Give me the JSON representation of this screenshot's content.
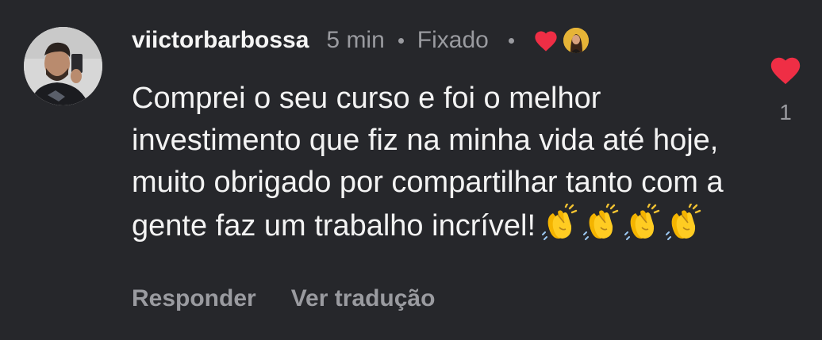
{
  "comment": {
    "username": "viictorbarbossa",
    "time": "5 min",
    "pinned_label": "Fixado",
    "text": "Comprei o seu curso e foi o melhor investimento que fiz na minha vida até hoje, muito obrigado por compartilhar tanto com a gente faz um trabalho incrível!",
    "emoji_icon": "clapping-hands-icon",
    "emoji_count": 4,
    "reply_label": "Responder",
    "translate_label": "Ver tradução",
    "like_count": "1"
  },
  "colors": {
    "background": "#26272b",
    "heart": "#ef2e45",
    "muted_text": "#9a9ba0",
    "primary_text": "#f3f3f3"
  }
}
